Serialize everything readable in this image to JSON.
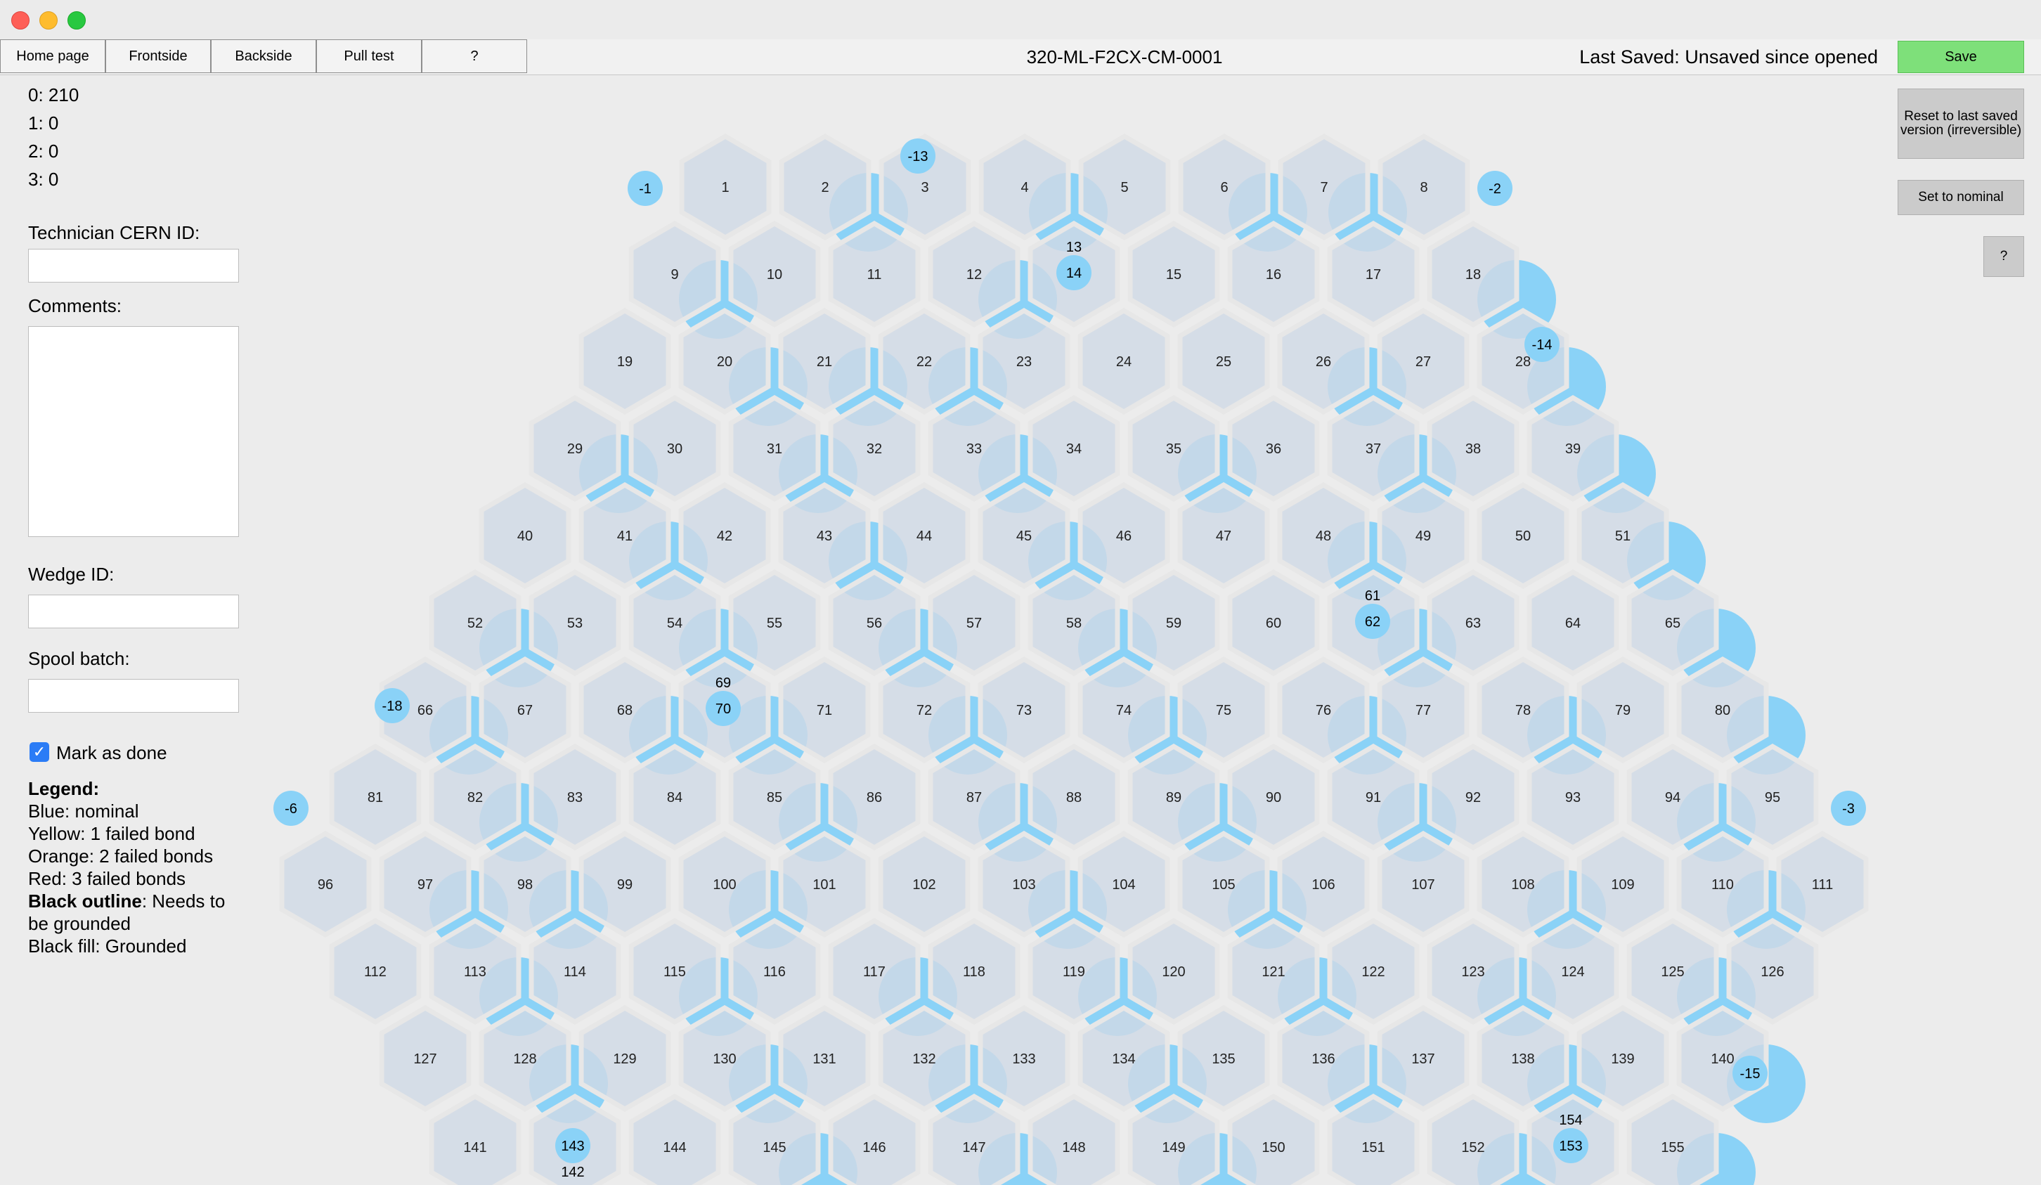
{
  "window": {
    "title": ""
  },
  "nav_tabs": [
    {
      "label": "Home page"
    },
    {
      "label": "Frontside"
    },
    {
      "label": "Backside"
    },
    {
      "label": "Pull test"
    },
    {
      "label": "?"
    }
  ],
  "header": {
    "file_title": "320-ML-F2CX-CM-0001",
    "last_saved": "Last Saved: Unsaved since opened",
    "save_label": "Save"
  },
  "side_buttons": {
    "reset_label": "Reset to last saved version (irreversible)",
    "nominal_label": "Set to nominal",
    "help_label": "?"
  },
  "counts": [
    {
      "text": "0: 210"
    },
    {
      "text": "1: 0"
    },
    {
      "text": "2: 0"
    },
    {
      "text": "3: 0"
    }
  ],
  "form": {
    "technician_label": "Technician CERN ID:",
    "technician_value": "",
    "comments_label": "Comments:",
    "comments_value": "",
    "wedge_label": "Wedge ID:",
    "wedge_value": "",
    "spool_label": "Spool batch:",
    "spool_value": "",
    "mark_done_label": "Mark as done",
    "mark_done_checked": true
  },
  "legend": {
    "title": "Legend:",
    "items": [
      {
        "text": "Blue: nominal"
      },
      {
        "text": "Yellow: 1 failed bond"
      },
      {
        "text": "Orange: 2 failed bonds"
      },
      {
        "text": "Red: 3 failed bonds"
      }
    ],
    "outline_bold": "Black outline",
    "outline_rest": ": Needs to be grounded",
    "fill_text": "Black fill: Grounded"
  },
  "colors": {
    "hex_fill": "#d0d9e5",
    "bond_nominal": "#8ad2f7",
    "save_green": "#7ee07a"
  },
  "hex_rows": [
    {
      "labels": [
        "1",
        "2",
        "3",
        "4",
        "5",
        "6",
        "7",
        "8"
      ]
    },
    {
      "labels": [
        "9",
        "10",
        "11",
        "12",
        "14",
        "15",
        "16",
        "17",
        "18"
      ]
    },
    {
      "labels": [
        "19",
        "20",
        "21",
        "22",
        "23",
        "24",
        "25",
        "26",
        "27",
        "28"
      ]
    },
    {
      "labels": [
        "29",
        "30",
        "31",
        "32",
        "33",
        "34",
        "35",
        "36",
        "37",
        "38",
        "39"
      ]
    },
    {
      "labels": [
        "40",
        "41",
        "42",
        "43",
        "44",
        "45",
        "46",
        "47",
        "48",
        "49",
        "50",
        "51"
      ]
    },
    {
      "labels": [
        "52",
        "53",
        "54",
        "55",
        "56",
        "57",
        "58",
        "59",
        "60",
        "62",
        "63",
        "64",
        "65"
      ]
    },
    {
      "labels": [
        "66",
        "67",
        "68",
        "70",
        "71",
        "72",
        "73",
        "74",
        "75",
        "76",
        "77",
        "78",
        "79",
        "80"
      ]
    },
    {
      "labels": [
        "81",
        "82",
        "83",
        "84",
        "85",
        "86",
        "87",
        "88",
        "89",
        "90",
        "91",
        "92",
        "93",
        "94",
        "95"
      ]
    },
    {
      "labels": [
        "96",
        "97",
        "98",
        "99",
        "100",
        "101",
        "102",
        "103",
        "104",
        "105",
        "106",
        "107",
        "108",
        "109",
        "110",
        "111"
      ]
    },
    {
      "labels": [
        "112",
        "113",
        "114",
        "115",
        "116",
        "117",
        "118",
        "119",
        "120",
        "121",
        "122",
        "123",
        "124",
        "125",
        "126"
      ]
    },
    {
      "labels": [
        "127",
        "128",
        "129",
        "130",
        "131",
        "132",
        "133",
        "134",
        "135",
        "136",
        "137",
        "138",
        "139",
        "140"
      ]
    },
    {
      "labels": [
        "141",
        "143",
        "144",
        "145",
        "146",
        "147",
        "148",
        "149",
        "150",
        "151",
        "152",
        "153",
        "155"
      ]
    }
  ],
  "pads": {
    "guard": [
      {
        "label": "-1"
      },
      {
        "label": "-13"
      },
      {
        "label": "-2"
      },
      {
        "label": "-14"
      },
      {
        "label": "-18"
      },
      {
        "label": "-6"
      },
      {
        "label": "-3"
      },
      {
        "label": "-15"
      }
    ],
    "calib": [
      {
        "label": "14",
        "above": "13"
      },
      {
        "label": "62",
        "above": "61"
      },
      {
        "label": "70",
        "above": "69"
      },
      {
        "label": "143",
        "below": "142"
      },
      {
        "label": "153",
        "above": "154"
      }
    ]
  }
}
